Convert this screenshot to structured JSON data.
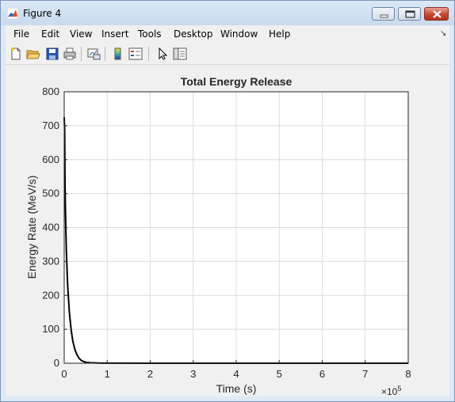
{
  "window": {
    "title": "Figure 4",
    "icons": {
      "app": "matlab-icon",
      "minimize": "minimize-icon",
      "maximize": "maximize-icon",
      "close": "close-icon"
    }
  },
  "menu": {
    "items": [
      "File",
      "Edit",
      "View",
      "Insert",
      "Tools",
      "Desktop",
      "Window",
      "Help"
    ],
    "overflow_icon": "menu-overflow-arrow-icon"
  },
  "toolbar": {
    "buttons": [
      "new-figure-icon",
      "open-file-icon",
      "save-icon",
      "print-icon",
      "link-plot-icon",
      "colorbar-icon",
      "legend-icon",
      "edit-plot-pointer-icon",
      "property-inspector-icon"
    ]
  },
  "chart_data": {
    "type": "line",
    "title": "Total Energy Release",
    "xlabel": "Time (s)",
    "ylabel": "Energy Rate (MeV/s)",
    "x_exponent_label": "×10",
    "x_exponent_power": "5",
    "xlim": [
      0,
      8
    ],
    "ylim": [
      0,
      800
    ],
    "x_units_note": "x values in units of 1e5 s",
    "xticks": [
      "0",
      "1",
      "2",
      "3",
      "4",
      "5",
      "6",
      "7",
      "8"
    ],
    "yticks": [
      "0",
      "100",
      "200",
      "300",
      "400",
      "500",
      "600",
      "700",
      "800"
    ],
    "grid": true,
    "line_color": "#000000",
    "series": [
      {
        "x": [
          0,
          0.01,
          0.02,
          0.03,
          0.05,
          0.08,
          0.12,
          0.16,
          0.2,
          0.25,
          0.3,
          0.35,
          0.4,
          0.45,
          0.5,
          0.6,
          0.8,
          1.0,
          2.0,
          4.0,
          6.0,
          8.0
        ],
        "values": [
          725,
          690,
          520,
          440,
          330,
          230,
          150,
          100,
          65,
          40,
          24,
          14,
          8,
          5,
          3,
          1.5,
          0.5,
          0.2,
          0,
          0,
          0,
          0
        ]
      }
    ]
  }
}
